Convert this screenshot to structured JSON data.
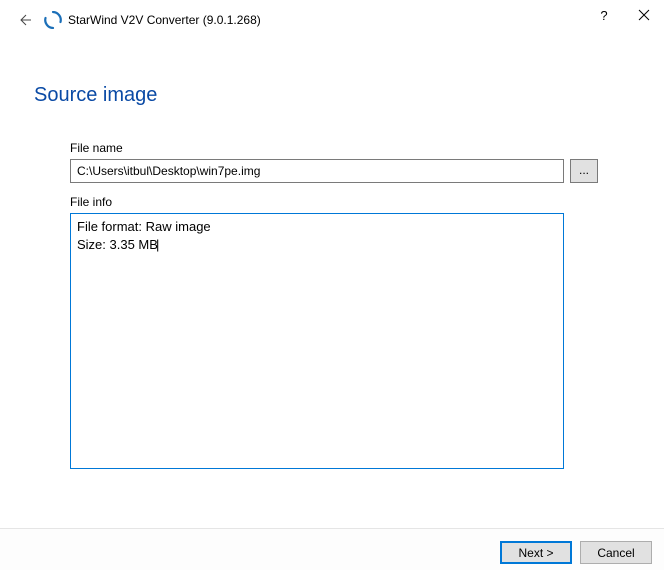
{
  "window": {
    "title": "StarWind V2V Converter (9.0.1.268)"
  },
  "heading": "Source image",
  "labels": {
    "file_name": "File name",
    "file_info": "File info"
  },
  "fields": {
    "file_path": "C:\\Users\\itbul\\Desktop\\win7pe.img",
    "browse_label": "..."
  },
  "file_info": {
    "format_line": "File format: Raw image",
    "size_line": "Size: 3.35 MB"
  },
  "buttons": {
    "next": "Next >",
    "cancel": "Cancel"
  }
}
